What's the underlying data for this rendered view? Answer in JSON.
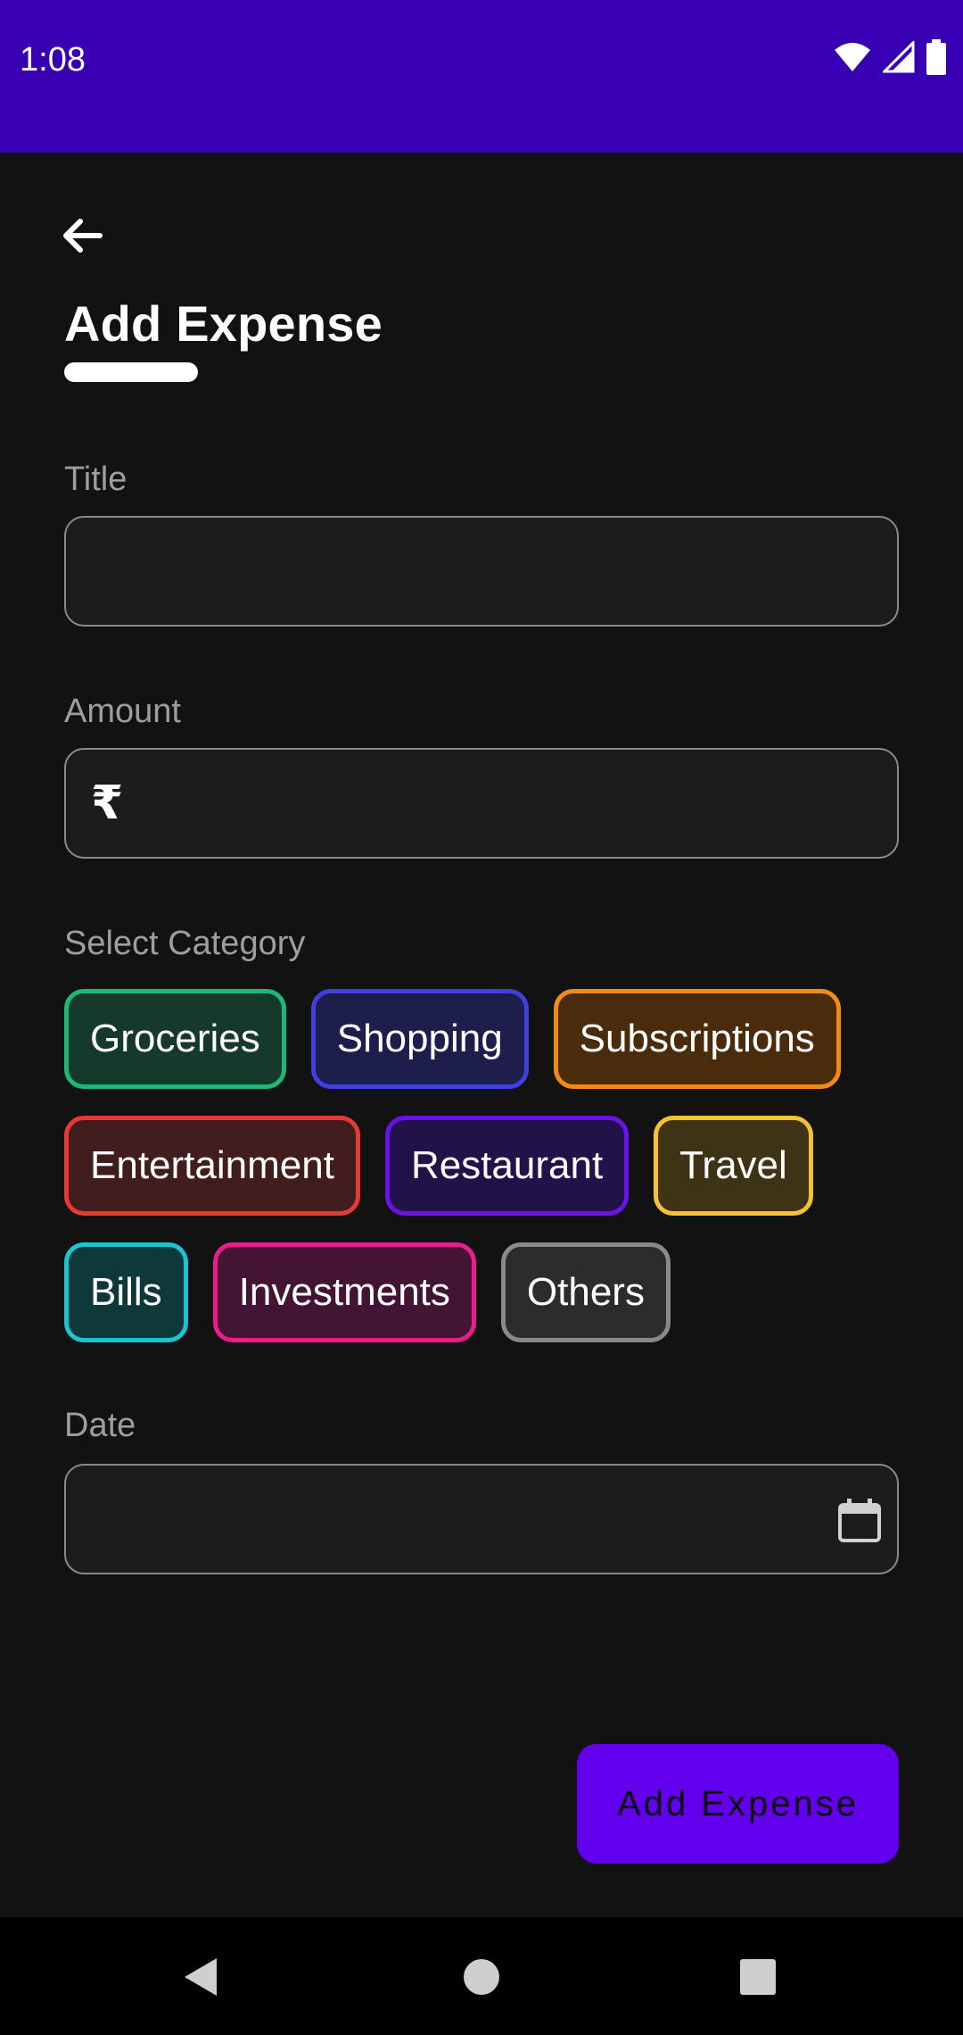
{
  "status_bar": {
    "time": "1:08"
  },
  "header": {
    "title": "Add Expense"
  },
  "form": {
    "title_label": "Title",
    "title_value": "",
    "amount_label": "Amount",
    "amount_prefix": "₹",
    "amount_value": "",
    "category_label": "Select Category",
    "date_label": "Date",
    "date_value": ""
  },
  "categories": [
    {
      "label": "Groceries",
      "border": "#1DB877",
      "fill": "#153A2B"
    },
    {
      "label": "Shopping",
      "border": "#4040E0",
      "fill": "#1E1E4C"
    },
    {
      "label": "Subscriptions",
      "border": "#F28B12",
      "fill": "#4A2C0C"
    },
    {
      "label": "Entertainment",
      "border": "#E53935",
      "fill": "#421D1D"
    },
    {
      "label": "Restaurant",
      "border": "#6A12E8",
      "fill": "#22124A"
    },
    {
      "label": "Travel",
      "border": "#F6C230",
      "fill": "#3E3315"
    },
    {
      "label": "Bills",
      "border": "#18C5D0",
      "fill": "#0E383A"
    },
    {
      "label": "Investments",
      "border": "#E91E8C",
      "fill": "#431433"
    },
    {
      "label": "Others",
      "border": "#8A8A8A",
      "fill": "#2C2C2C"
    }
  ],
  "submit": {
    "label": "Add Expense"
  },
  "colors": {
    "status_bar": "#3700B3",
    "accent": "#6200EE",
    "background": "#121212"
  }
}
